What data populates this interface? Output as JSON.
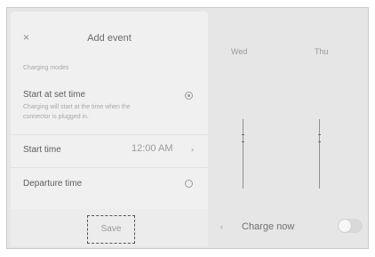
{
  "dialog": {
    "title": "Add event",
    "close_icon": "×",
    "section_label": "Charging modes",
    "start_at_set_time": {
      "title": "Start at set time",
      "description": "Charging will start at the time when the connector is plugged in."
    },
    "start_time": {
      "label": "Start time",
      "value": "12:00 AM",
      "chevron": "›"
    },
    "departure_time": {
      "label": "Departure time"
    },
    "save_label": "Save"
  },
  "calendar": {
    "days": [
      "Wed",
      "Thu"
    ],
    "charge_now_label": "Charge now",
    "charge_now_icon": "‹",
    "toggle_state": "off"
  }
}
